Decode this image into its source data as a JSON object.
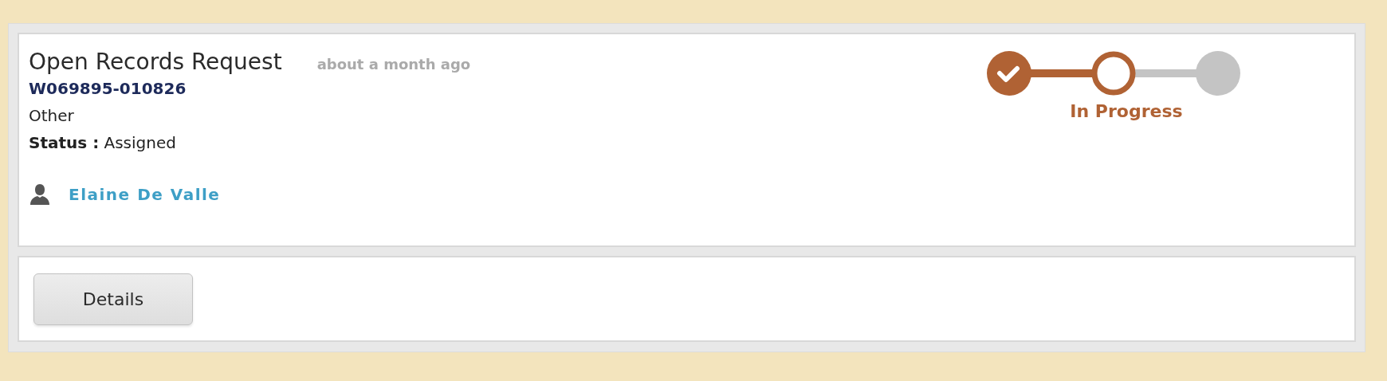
{
  "request": {
    "title": "Open Records Request",
    "age": "about a month ago",
    "number": "W069895-010826",
    "category": "Other",
    "status_label": "Status :",
    "status_value": "Assigned",
    "assignee": "Elaine De Valle"
  },
  "progress": {
    "steps": [
      {
        "completed": true,
        "current": false
      },
      {
        "completed": false,
        "current": true
      },
      {
        "completed": false,
        "current": false
      }
    ],
    "label": "In Progress"
  },
  "actions": [
    {
      "label": "Details"
    }
  ]
}
